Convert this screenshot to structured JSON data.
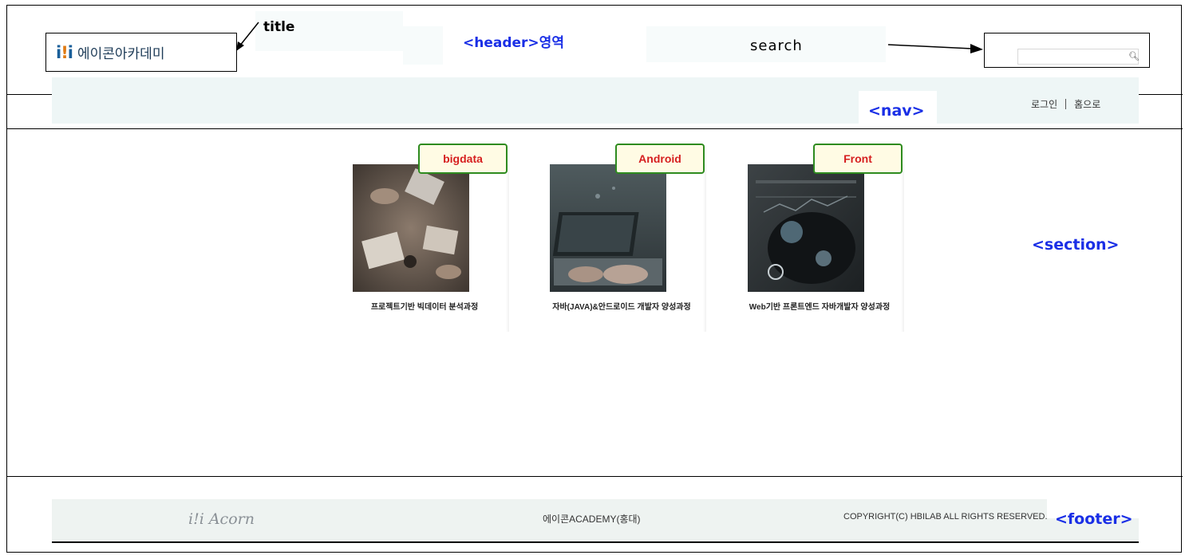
{
  "header": {
    "logo_mark": "i!i",
    "logo_text": "에이콘아카데미",
    "annotation_title": "title",
    "annotation_header": "<header>영역",
    "annotation_search": "search",
    "search_placeholder": ""
  },
  "nav": {
    "annotation": "<nav>",
    "login": "로그인",
    "home": "홈으로"
  },
  "section": {
    "annotation": "<section>",
    "cards": [
      {
        "tag": "bigdata",
        "caption": "프로젝트기반 빅데이터 분석과정"
      },
      {
        "tag": "Android",
        "caption": "자바(JAVA)&안드로이드 개발자 양성과정"
      },
      {
        "tag": "Front",
        "caption": "Web기반 프론트엔드 자바개발자 양성과정"
      }
    ]
  },
  "footer": {
    "annotation": "<footer>",
    "logo": "i!i Acorn",
    "center_text": "에이콘ACADEMY(홍대)",
    "copyright": "COPYRIGHT(C) HBILAB ALL RIGHTS RESERVED."
  },
  "colors": {
    "annotation_blue": "#1a2fe6",
    "tag_border": "#2e8b1f",
    "tag_text": "#d62020",
    "tag_bg": "#fffbe4",
    "strip_bg": "#eef6f6"
  }
}
